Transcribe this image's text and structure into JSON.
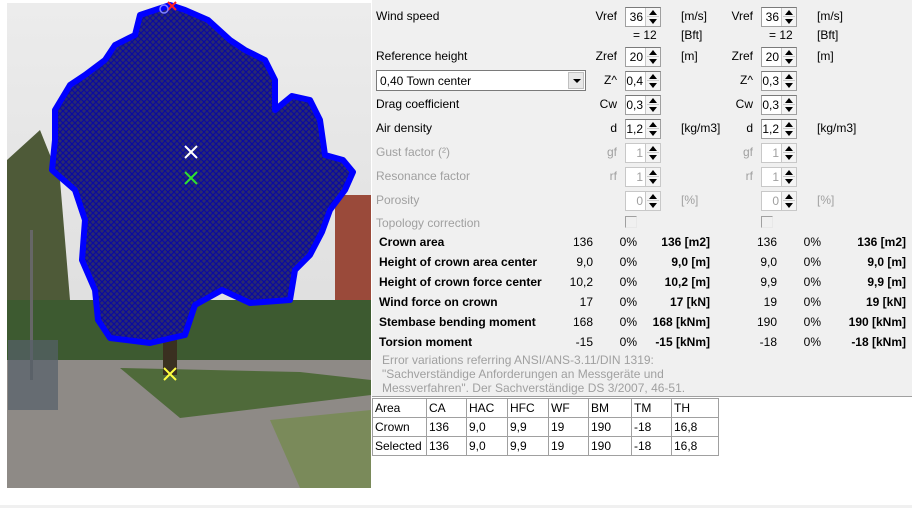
{
  "photo": {
    "crown_outline_color": "#0000ff",
    "hatch_color": "#0a0a8c",
    "markers": [
      "red-x",
      "blue-circle",
      "white-x",
      "green-x",
      "yellow-x"
    ]
  },
  "params": {
    "wind_speed": {
      "label": "Wind speed",
      "sym": "Vref",
      "v1": "36",
      "v2": "36",
      "unit": "[m/s]"
    },
    "bft": {
      "eq1": "= 12",
      "eq2": "= 12",
      "unit": "[Bft]"
    },
    "ref_height": {
      "label": "Reference height",
      "sym": "Zref",
      "v1": "20",
      "v2": "20",
      "unit": "[m]"
    },
    "roughness": {
      "selected": "0,40 Town center",
      "sym": "Z^",
      "v1": "0,4",
      "v2": "0,3"
    },
    "drag": {
      "label": "Drag coefficient",
      "sym": "Cw",
      "v1": "0,3",
      "v2": "0,3"
    },
    "air": {
      "label": "Air density",
      "sym": "d",
      "v1": "1,2",
      "v2": "1,2",
      "unit": "[kg/m3]"
    },
    "gust": {
      "label": "Gust factor (²)",
      "sym": "gf",
      "v1": "1",
      "v2": "1"
    },
    "resonance": {
      "label": "Resonance factor",
      "sym": "rf",
      "v1": "1",
      "v2": "1"
    },
    "porosity": {
      "label": "Porosity",
      "v1": "0",
      "v2": "0",
      "unit": "[%]"
    },
    "topology": {
      "label": "Topology correction",
      "c1": false,
      "c2": false
    }
  },
  "results": [
    {
      "label": "Crown area",
      "a": "136",
      "ap": "0%",
      "ab": "136 [m2]",
      "b": "136",
      "bp": "0%",
      "bb": "136 [m2]"
    },
    {
      "label": "Height of crown area center",
      "a": "9,0",
      "ap": "0%",
      "ab": "9,0 [m]",
      "b": "9,0",
      "bp": "0%",
      "bb": "9,0 [m]"
    },
    {
      "label": "Height of crown force center",
      "a": "10,2",
      "ap": "0%",
      "ab": "10,2 [m]",
      "b": "9,9",
      "bp": "0%",
      "bb": "9,9 [m]"
    },
    {
      "label": "Wind force on crown",
      "a": "17",
      "ap": "0%",
      "ab": "17 [kN]",
      "b": "19",
      "bp": "0%",
      "bb": "19 [kN]"
    },
    {
      "label": "Stembase bending moment",
      "a": "168",
      "ap": "0%",
      "ab": "168 [kNm]",
      "b": "190",
      "bp": "0%",
      "bb": "190 [kNm]"
    },
    {
      "label": "Torsion moment",
      "a": "-15",
      "ap": "0%",
      "ab": "-15 [kNm]",
      "b": "-18",
      "bp": "0%",
      "bb": "-18 [kNm]"
    }
  ],
  "note": [
    "Error variations referring ANSI/ANS-3.11/DIN 1319:",
    "\"Sachverständige Anforderungen an Messgeräte und",
    "Messverfahren\". Der Sachverständige DS 3/2007,  46-51."
  ],
  "table": {
    "headers": [
      "Area",
      "CA",
      "HAC",
      "HFC",
      "WF",
      "BM",
      "TM",
      "TH"
    ],
    "rows": [
      [
        "Crown",
        "136",
        "9,0",
        "9,9",
        "19",
        "190",
        "-18",
        "16,8"
      ],
      [
        "Selected",
        "136",
        "9,0",
        "9,9",
        "19",
        "190",
        "-18",
        "16,8"
      ]
    ]
  }
}
